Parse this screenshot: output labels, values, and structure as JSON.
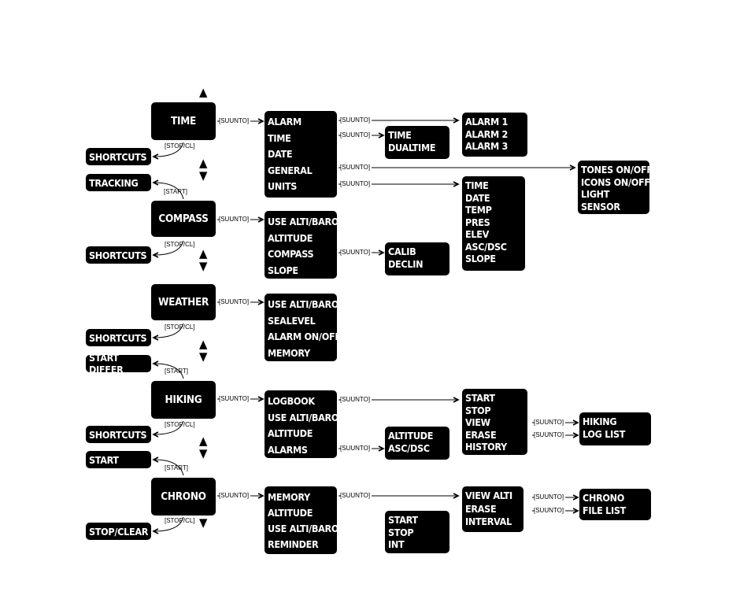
{
  "modes": {
    "time": "TIME",
    "compass": "COMPASS",
    "weather": "WEATHER",
    "hiking": "HIKING",
    "chrono": "CHRONO"
  },
  "side": {
    "shortcuts1": "SHORTCUTS",
    "tracking": "TRACKING",
    "shortcuts2": "SHORTCUTS",
    "shortcuts3": "SHORTCUTS",
    "start_differ": "START DIFFER",
    "shortcuts4": "SHORTCUTS",
    "start": "START",
    "stop_clear": "STOP/CLEAR"
  },
  "menus": {
    "time_menu": [
      "ALARM",
      "TIME",
      "DATE",
      "GENERAL",
      "UNITS"
    ],
    "compass_menu": [
      "USE ALTI/BARO",
      "ALTITUDE",
      "COMPASS",
      "SLOPE"
    ],
    "weather_menu": [
      "USE ALTI/BARO",
      "SEALEVEL",
      "ALARM ON/OFF",
      "MEMORY"
    ],
    "hiking_menu": [
      "LOGBOOK",
      "USE ALTI/BARO",
      "ALTITUDE",
      "ALARMS"
    ],
    "chrono_menu": [
      "MEMORY",
      "ALTITUDE",
      "USE ALTI/BARO",
      "REMINDER"
    ],
    "time_sub": [
      "TIME",
      "DUALTIME"
    ],
    "alarm_sub": [
      "ALARM 1",
      "ALARM  2",
      "ALARM 3"
    ],
    "general_sub": [
      "TONES ON/OFF",
      "ICONS ON/OFF",
      "LIGHT",
      "SENSOR"
    ],
    "units_sub": [
      "TIME",
      "DATE",
      "TEMP",
      "PRES",
      "ELEV",
      "ASC/DSC",
      "SLOPE"
    ],
    "compass_sub": [
      "CALIB",
      "DECLIN"
    ],
    "logbook_sub": [
      "START",
      "STOP",
      "VIEW",
      "ERASE",
      "HISTORY"
    ],
    "hiking_log": [
      "HIKING",
      "LOG LIST"
    ],
    "alarms_sub": [
      "ALTITUDE",
      "ASC/DSC"
    ],
    "memory_sub": [
      "VIEW ALTI",
      "ERASE",
      "INTERVAL"
    ],
    "chrono_file": [
      "CHRONO",
      "FILE LIST"
    ],
    "reminder_sub": [
      "START",
      "STOP",
      "INT"
    ]
  },
  "buttons": {
    "suunto": "[SUUNTO]",
    "stop_cl": "[STOP/CL]",
    "start": "[START]"
  }
}
